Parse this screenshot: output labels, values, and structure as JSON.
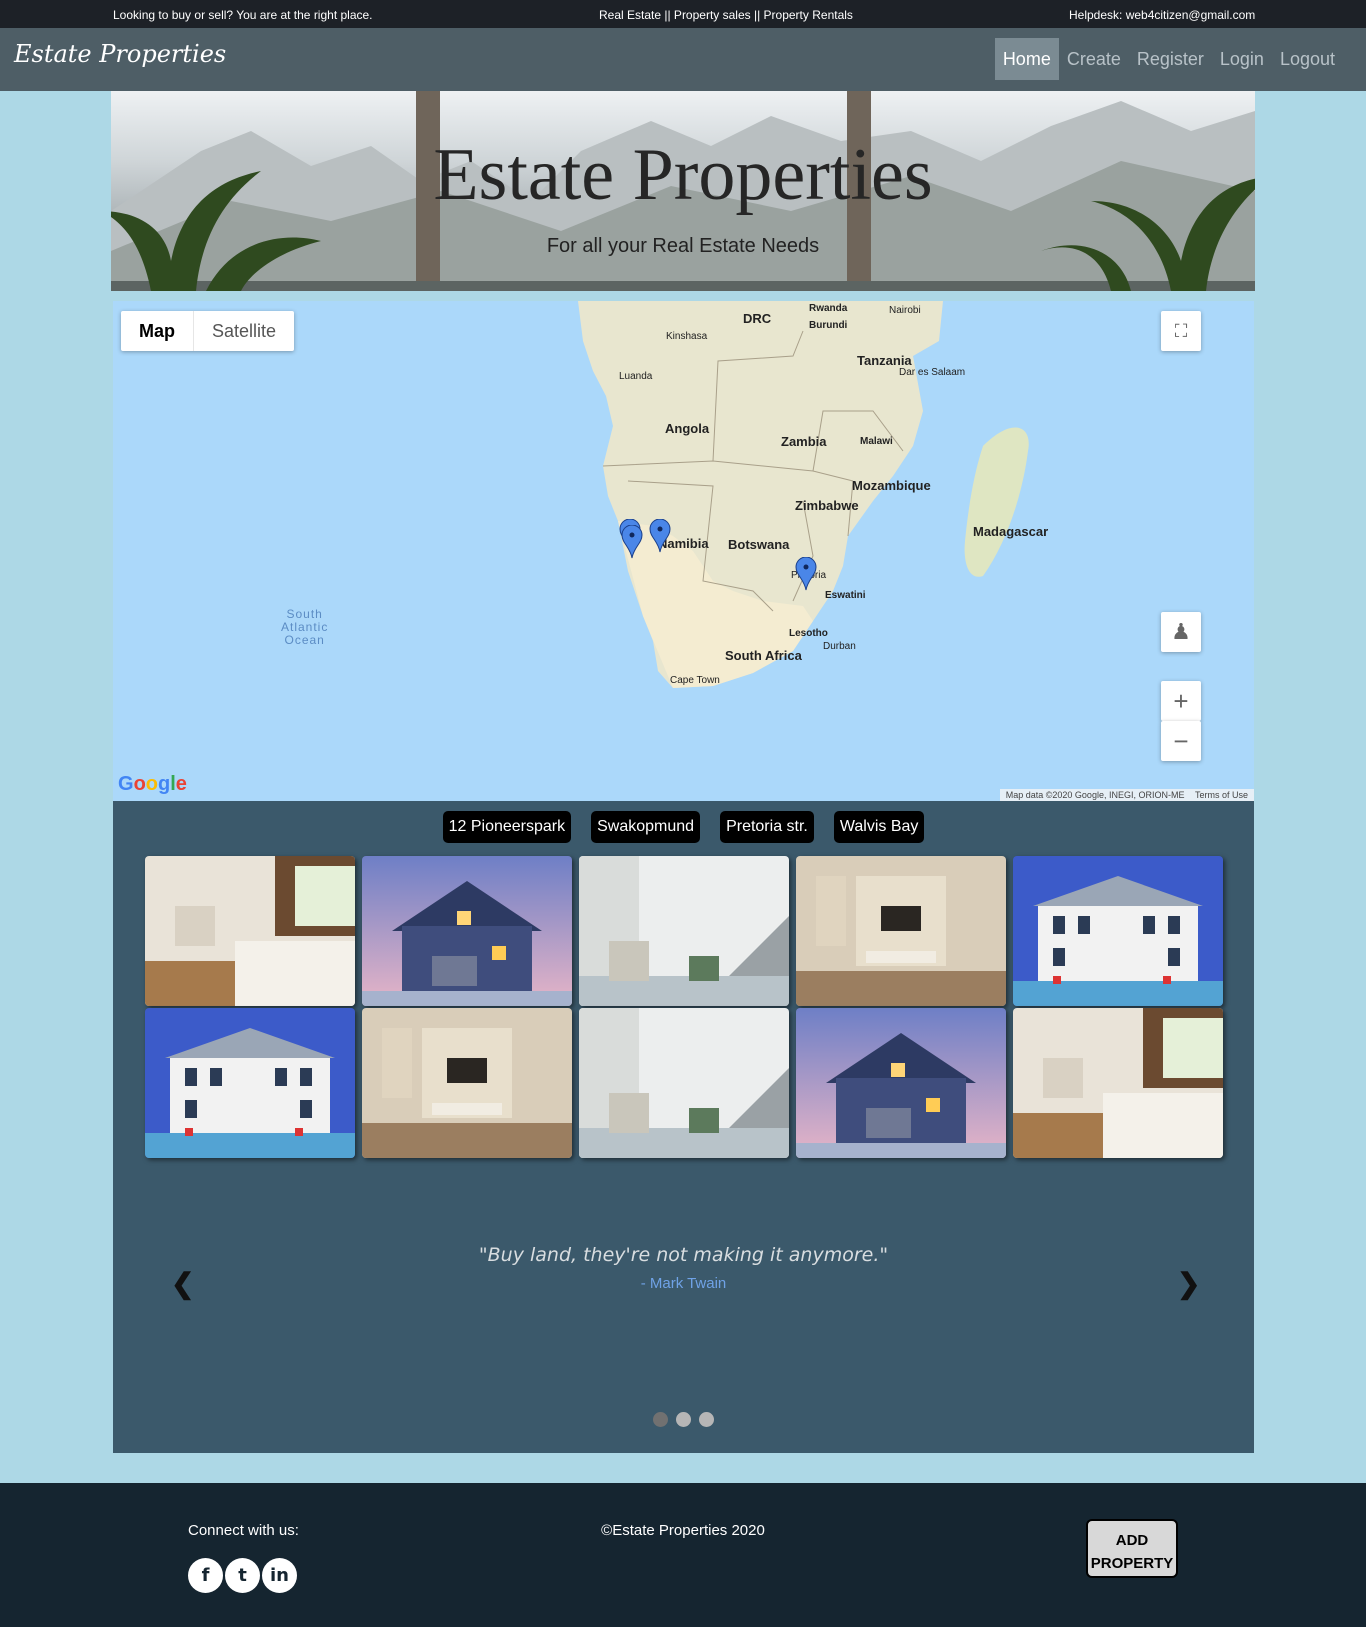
{
  "topbar": {
    "left": "Looking to buy or sell? You are at the right place.",
    "center": "Real Estate || Property sales || Property Rentals",
    "right": "Helpdesk: web4citizen@gmail.com"
  },
  "navbar": {
    "brand": "Estate Properties",
    "links": [
      "Home",
      "Create",
      "Register",
      "Login",
      "Logout"
    ],
    "active": "Home"
  },
  "banner": {
    "title": "Estate Properties",
    "subtitle": "For all your Real Estate Needs"
  },
  "map": {
    "type_options": [
      "Map",
      "Satellite"
    ],
    "selected_type": "Map",
    "labels": {
      "drc": "DRC",
      "rwanda": "Rwanda",
      "burundi": "Burundi",
      "nairobi": "Nairobi",
      "kinshasa": "Kinshasa",
      "luanda": "Luanda",
      "tanzania": "Tanzania",
      "dar": "Dar es Salaam",
      "angola": "Angola",
      "zambia": "Zambia",
      "malawi": "Malawi",
      "mozambique": "Mozambique",
      "zimbabwe": "Zimbabwe",
      "madagascar": "Madagascar",
      "namibia": "Namibia",
      "botswana": "Botswana",
      "pretoria": "Pretoria",
      "eswatini": "Eswatini",
      "lesotho": "Lesotho",
      "durban": "Durban",
      "south_africa": "South Africa",
      "cape_town": "Cape Town",
      "ocean": "South Atlantic Ocean"
    },
    "ocean_lines": [
      "South",
      "Atlantic",
      "Ocean"
    ],
    "logo": "Google",
    "attribution": "Map data ©2020 Google, INEGI, ORION-ME",
    "terms": "Terms of Use",
    "zoom_in": "+",
    "zoom_out": "−"
  },
  "listings": {
    "tags": [
      "12 Pioneerspark",
      "Swakopmund",
      "Pretoria str.",
      "Walvis Bay"
    ],
    "photos": [
      "kitchen",
      "house",
      "staircase",
      "living-room",
      "mansion",
      "mansion",
      "living-room",
      "staircase",
      "house",
      "kitchen"
    ]
  },
  "testimonial": {
    "quote": "\"Buy land, they're not making it anymore.\"",
    "author": "- Mark Twain",
    "prev": "❮",
    "next": "❯",
    "slides": 3,
    "active_slide": 1
  },
  "footer": {
    "connect": "Connect with us:",
    "social": [
      "facebook-icon",
      "twitter-icon",
      "linkedin-icon"
    ],
    "copyright": "©Estate Properties 2020",
    "add_button_line1": "ADD",
    "add_button_line2": "PROPERTY"
  }
}
